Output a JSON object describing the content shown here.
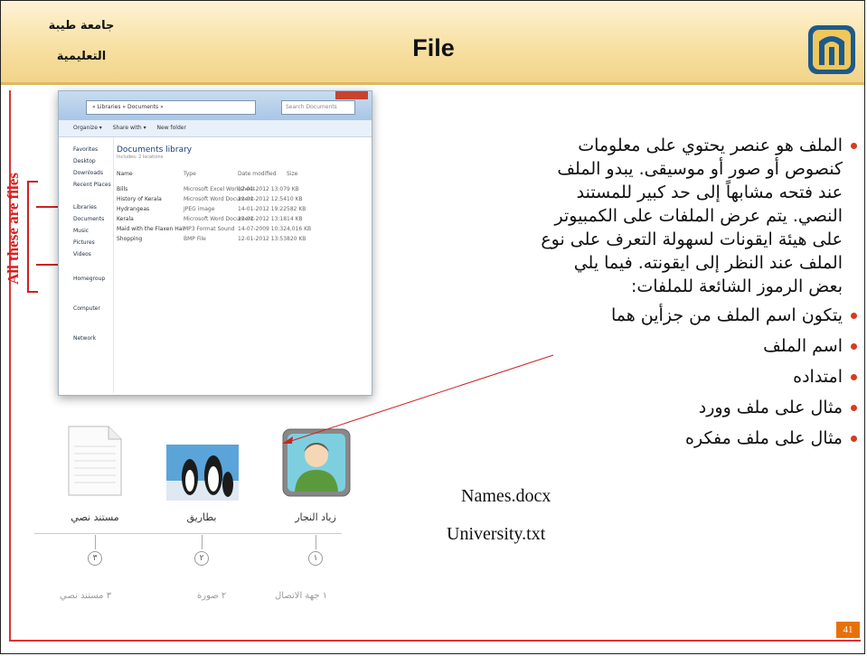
{
  "header": {
    "title": "File",
    "university_line1": "جامعة طيبة",
    "university_line2": "التعليمية"
  },
  "side_label": "All these are files",
  "explorer": {
    "address": "« Libraries » Documents »",
    "search_placeholder": "Search Documents",
    "toolbar": [
      "Organize ▾",
      "Share with ▾",
      "New folder"
    ],
    "nav": [
      "Favorites",
      "Desktop",
      "Downloads",
      "Recent Places",
      "Libraries",
      "Documents",
      "Music",
      "Pictures",
      "Videos",
      "Homegroup",
      "Computer",
      "Network"
    ],
    "library_title": "Documents library",
    "library_sub": "Includes: 2 locations",
    "columns": [
      "Name",
      "Type",
      "Date modified",
      "Size"
    ],
    "files": [
      {
        "name": "Bills",
        "type": "Microsoft Excel Worksheet",
        "date": "12-01-2012 13:07",
        "size": "9 KB"
      },
      {
        "name": "History of Kerala",
        "type": "Microsoft Word Document",
        "date": "12-01-2012 12:54",
        "size": "10 KB"
      },
      {
        "name": "Hydrangeas",
        "type": "JPEG image",
        "date": "14-01-2012 19:22",
        "size": "582 KB"
      },
      {
        "name": "Kerala",
        "type": "Microsoft Word Document",
        "date": "12-01-2012 13:18",
        "size": "14 KB"
      },
      {
        "name": "Maid with the Flaxen Hair",
        "type": "MP3 Format Sound",
        "date": "14-07-2009 10:32",
        "size": "4,016 KB"
      },
      {
        "name": "Shopping",
        "type": "BMP File",
        "date": "12-01-2012 13:53",
        "size": "820 KB"
      }
    ]
  },
  "icons_panel": {
    "items": [
      {
        "caption": "زياد النجار",
        "number": "١",
        "lower": "جهة الاتصال",
        "icon": "contact-icon"
      },
      {
        "caption": "بطاريق",
        "number": "٢",
        "lower": "صورة",
        "icon": "image-icon"
      },
      {
        "caption": "مستند نصي",
        "number": "٣",
        "lower": "مستند نصي",
        "icon": "text-document-icon"
      }
    ]
  },
  "bullets": {
    "main": [
      "الملف هو عنصر يحتوي على معلومات",
      "كنصوص أو صور أو موسيقى. يبدو الملف",
      "عند فتحه مشابهاً إلى حد كبير للمستند",
      "النصي. يتم عرض الملفات على الكمبيوتر",
      "على هيئة ايقونات لسهولة التعرف على نوع",
      "الملف عند النظر إلى ايقونته. فيما يلي",
      "بعض الرموز الشائعة للملفات:"
    ],
    "parts": "يتكون اسم الملف من جزأين هما",
    "name": "اسم الملف",
    "extension": "امتداده",
    "word_example": "مثال على ملف وورد",
    "word_file": "Names.docx",
    "notepad_example": "مثال على ملف مفكره",
    "notepad_file": "University.txt"
  },
  "page_number": "41",
  "colors": {
    "accent": "#d93a1c",
    "header": "#f7dfa0",
    "page_badge": "#e8700a"
  }
}
